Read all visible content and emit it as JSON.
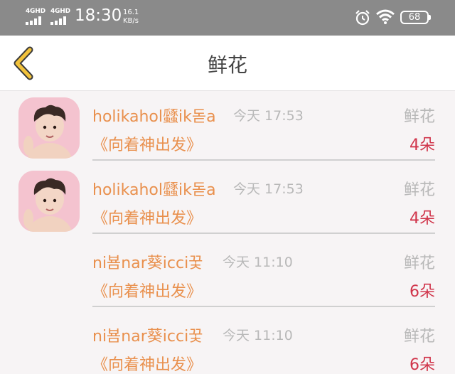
{
  "status_bar": {
    "network_1": "4GHD",
    "network_2": "4GHD",
    "time": "18:30",
    "speed_value": "16.1",
    "speed_unit": "KB/s",
    "battery": "68",
    "icons": [
      "signal-icon",
      "signal-icon",
      "alarm-icon",
      "wifi-icon",
      "battery-icon"
    ]
  },
  "header": {
    "title": "鲜花",
    "back_icon": "chevron-left-icon"
  },
  "colors": {
    "name": "#e9904d",
    "count": "#d0344a",
    "muted": "#b8b8b8",
    "back_icon": "#f2c23b"
  },
  "list": [
    {
      "has_avatar": true,
      "name": "holikahol瓥ik돋a",
      "time": "今天 17:53",
      "gift": "鲜花",
      "book": "《向着神出发》",
      "count": "4朵"
    },
    {
      "has_avatar": true,
      "name": "holikahol瓥ik돋a",
      "time": "今天 17:53",
      "gift": "鲜花",
      "book": "《向着神出发》",
      "count": "4朵"
    },
    {
      "has_avatar": false,
      "name": "ni뵴nar葵icci꿏",
      "time": "今天 11:10",
      "gift": "鲜花",
      "book": "《向着神出发》",
      "count": "6朵"
    },
    {
      "has_avatar": false,
      "name": "ni뵴nar葵icci꿏",
      "time": "今天 11:10",
      "gift": "鲜花",
      "book": "《向着神出发》",
      "count": "6朵"
    }
  ]
}
